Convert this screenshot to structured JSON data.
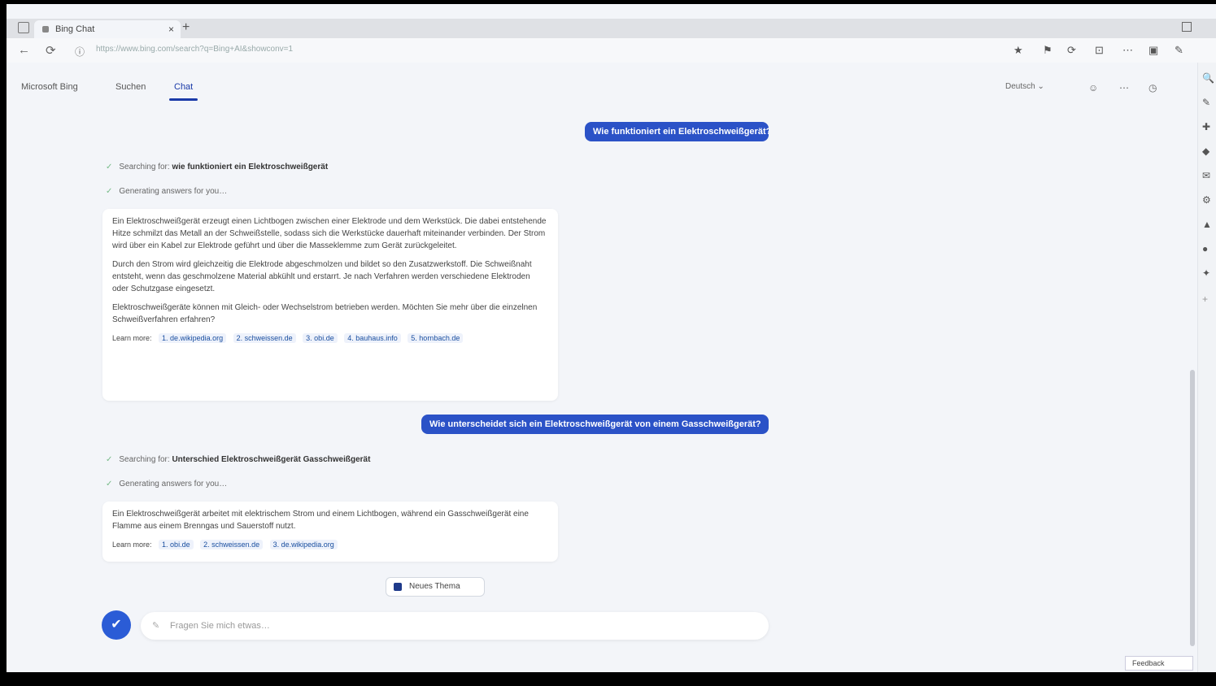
{
  "browser": {
    "tab_title": "Bing Chat",
    "tab_close": "×",
    "new_tab": "+",
    "url": "https://www.bing.com/search?q=Bing+AI&showconv=1",
    "nav": {
      "back": "←",
      "refresh": "⟳",
      "info": "ⓘ"
    },
    "toolbar_icons": [
      "★",
      "⚑",
      "⟳",
      "⊡",
      "⋯",
      "▣",
      "✎"
    ]
  },
  "sidebar": {
    "icons": [
      "🔍",
      "✎",
      "✚",
      "◆",
      "✉",
      "⚙",
      "▲",
      "●",
      "✦",
      "+"
    ]
  },
  "app": {
    "modes": [
      {
        "label": "Microsoft Bing"
      },
      {
        "label": "Suchen"
      },
      {
        "label": "Chat"
      }
    ],
    "header_right": {
      "language": "Deutsch ⌄",
      "icons": [
        "☺",
        "⋯",
        "◷"
      ]
    }
  },
  "conversation": {
    "user_messages": [
      "Wie funktioniert ein Elektroschweißgerät?",
      "Wie unterscheidet sich ein Elektroschweißgerät von einem Gasschweißgerät?"
    ],
    "steps_1": [
      {
        "prefix": "Searching for:",
        "query": "wie funktioniert ein Elektroschweißgerät"
      },
      {
        "prefix": "Generating answers for you…",
        "query": ""
      }
    ],
    "answer_1": {
      "paragraphs": [
        "Ein Elektroschweißgerät erzeugt einen Lichtbogen zwischen einer Elektrode und dem Werkstück. Die dabei entstehende Hitze schmilzt das Metall an der Schweißstelle, sodass sich die Werkstücke dauerhaft miteinander verbinden. Der Strom wird über ein Kabel zur Elektrode geführt und über die Masseklemme zum Gerät zurückgeleitet.",
        "Durch den Strom wird gleichzeitig die Elektrode abgeschmolzen und bildet so den Zusatzwerkstoff. Die Schweißnaht entsteht, wenn das geschmolzene Material abkühlt und erstarrt. Je nach Verfahren werden verschiedene Elektroden oder Schutzgase eingesetzt.",
        "Elektroschweißgeräte können mit Gleich- oder Wechselstrom betrieben werden. Möchten Sie mehr über die einzelnen Schweißverfahren erfahren?"
      ],
      "learn_more_label": "Learn more:",
      "sources": [
        "1. de.wikipedia.org",
        "2. schweissen.de",
        "3. obi.de",
        "4. bauhaus.info",
        "5. hornbach.de"
      ]
    },
    "steps_2": [
      {
        "prefix": "Searching for:",
        "query": "Unterschied Elektroschweißgerät Gasschweißgerät"
      },
      {
        "prefix": "Generating answers for you…",
        "query": ""
      }
    ],
    "answer_2": {
      "paragraphs": [
        "Ein Elektroschweißgerät arbeitet mit elektrischem Strom und einem Lichtbogen, während ein Gasschweißgerät eine Flamme aus einem Brenngas und Sauerstoff nutzt."
      ],
      "learn_more_label": "Learn more:",
      "sources": [
        "1. obi.de",
        "2. schweissen.de",
        "3. de.wikipedia.org"
      ]
    },
    "new_topic_label": "Neues Thema"
  },
  "composer": {
    "placeholder": "Fragen Sie mich etwas…",
    "input_icon": "✎",
    "avatar_icon": "✔"
  },
  "feedback_label": "Feedback"
}
